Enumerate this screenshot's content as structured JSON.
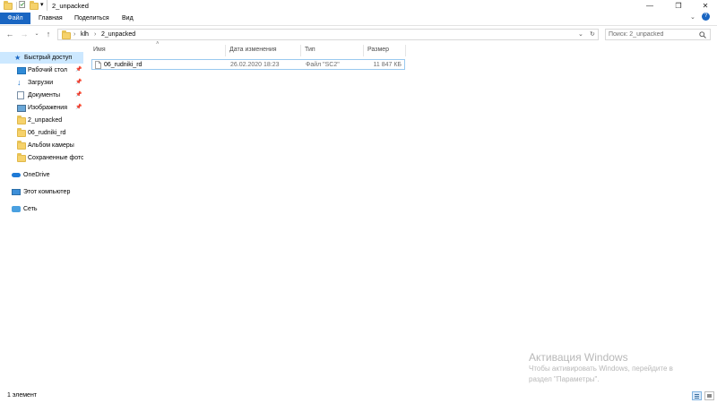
{
  "window": {
    "title": "2_unpacked",
    "controls": {
      "minimize": "—",
      "maximize": "❐",
      "close": "✕"
    }
  },
  "ribbon": {
    "tabs": [
      "Файл",
      "Главная",
      "Поделиться",
      "Вид"
    ]
  },
  "address": {
    "breadcrumbs": [
      "klh",
      "2_unpacked"
    ],
    "separator": "›",
    "search_placeholder": "Поиск: 2_unpacked"
  },
  "sidebar": {
    "items": [
      {
        "label": "Быстрый доступ",
        "icon": "star-icon",
        "pinned": false
      },
      {
        "label": "Рабочий стол",
        "icon": "desktop-icon",
        "pinned": true
      },
      {
        "label": "Загрузки",
        "icon": "download-icon",
        "pinned": true
      },
      {
        "label": "Документы",
        "icon": "documents-icon",
        "pinned": true
      },
      {
        "label": "Изображения",
        "icon": "pictures-icon",
        "pinned": true
      },
      {
        "label": "2_unpacked",
        "icon": "folder-icon",
        "pinned": false
      },
      {
        "label": "06_rudniki_rd",
        "icon": "folder-icon",
        "pinned": false
      },
      {
        "label": "Альбом камеры",
        "icon": "folder-icon",
        "pinned": false
      },
      {
        "label": "Сохраненные фото",
        "icon": "folder-icon",
        "pinned": false
      },
      {
        "label": "OneDrive",
        "icon": "onedrive-icon",
        "pinned": false
      },
      {
        "label": "Этот компьютер",
        "icon": "computer-icon",
        "pinned": false
      },
      {
        "label": "Сеть",
        "icon": "network-icon",
        "pinned": false
      }
    ]
  },
  "list": {
    "columns": [
      "Имя",
      "Дата изменения",
      "Тип",
      "Размер"
    ],
    "rows": [
      {
        "name": "06_rudniki_rd",
        "modified": "26.02.2020 18:23",
        "type": "Файл \"SC2\"",
        "size": "11 847 КБ"
      }
    ]
  },
  "status": {
    "count": "1 элемент"
  },
  "watermark": {
    "title": "Активация Windows",
    "line1": "Чтобы активировать Windows, перейдите в",
    "line2": "раздел \"Параметры\"."
  },
  "colors": {
    "accent": "#1a66c2",
    "selection": "#cce8ff",
    "folder": "#f6d26b"
  }
}
